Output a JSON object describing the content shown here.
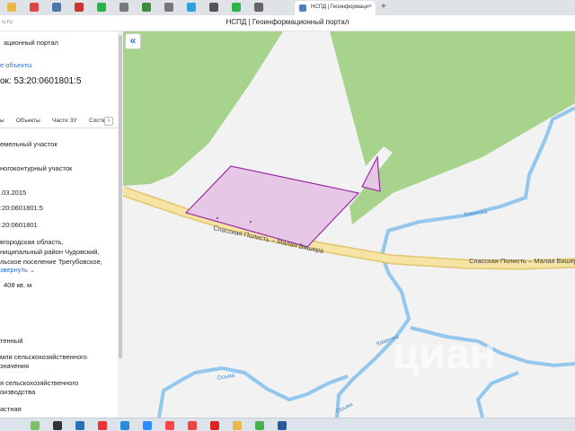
{
  "browser": {
    "url_fragment": "u.ru",
    "active_tab_title": "НСПД | Геоинформаци",
    "page_title": "НСПД | Геоинформационный портал",
    "new_tab_label": "+",
    "close_tab_label": "×"
  },
  "panel": {
    "portal_name": "ационный портал",
    "nearby_link": "е объекты",
    "cadastral_heading": "ок: 53:20:0601801:5",
    "tabs": [
      "ы",
      "Объекты",
      "Части ЗУ",
      "Соств"
    ],
    "tabs_next": "›",
    "fields": {
      "type": "емельный участок",
      "subtype": "ногоконтурный участок",
      "date": ".03.2015",
      "number": ":20:0601801:5",
      "quarter": ":20:0601801",
      "address_line1": "вгородская область,",
      "address_line2": "ниципальный район Чудовский,",
      "address_line3": "льское поселение Трегубовское,",
      "expand_link": "звернуть",
      "area": "408 кв. м",
      "status": "тенный",
      "category_line1": "мли сельскохозяйственного",
      "category_line2": "значения",
      "use_line1": "я сельскохозяйственного",
      "use_line2": "оизводства",
      "ownership": "астная"
    }
  },
  "map": {
    "collapse_label": "«",
    "road_label_1": "Спасская Полисть – Малая Вишера",
    "road_label_2": "Спасская Полисть – Малая Вишера",
    "river_label_1": "Каменка",
    "river_label_2": "Каменка",
    "river_label_3": "Осьма",
    "river_label_4": "Осьма",
    "watermark": "циан",
    "colors": {
      "forest": "#a8d38c",
      "background": "#f2f2f2",
      "parcel_fill": "#e6c8e6",
      "parcel_stroke": "#9b2aa6",
      "road": "#f3dc8e",
      "river": "#93c7ee"
    }
  },
  "browser_tab_icons": [
    {
      "name": "folder-icon",
      "color": "#e8b84a"
    },
    {
      "name": "mail-icon",
      "color": "#d44"
    },
    {
      "name": "vk-icon",
      "color": "#4a76a8"
    },
    {
      "name": "gmail-icon",
      "color": "#c33"
    },
    {
      "name": "whatsapp-icon",
      "color": "#2bb34a"
    },
    {
      "name": "site-icon",
      "color": "#7a7a7a"
    },
    {
      "name": "site-icon",
      "color": "#3c8d3c"
    },
    {
      "name": "site-icon",
      "color": "#777"
    },
    {
      "name": "telegram-icon",
      "color": "#2aa3de"
    },
    {
      "name": "site-icon",
      "color": "#555"
    },
    {
      "name": "whatsapp-icon",
      "color": "#2bb34a"
    },
    {
      "name": "site-icon",
      "color": "#666"
    }
  ],
  "taskbar_icons": [
    {
      "name": "photos-icon",
      "color": "#7fbf6a"
    },
    {
      "name": "video-icon",
      "color": "#333"
    },
    {
      "name": "media-icon",
      "color": "#2b6fb5"
    },
    {
      "name": "yandex-icon",
      "color": "#e33"
    },
    {
      "name": "skype-icon",
      "color": "#2b8dd8"
    },
    {
      "name": "zoom-icon",
      "color": "#2d8cff"
    },
    {
      "name": "yandex-browser-icon",
      "color": "#f44"
    },
    {
      "name": "chrome-icon",
      "color": "#e44"
    },
    {
      "name": "opera-icon",
      "color": "#d22"
    },
    {
      "name": "explorer-icon",
      "color": "#e8b84a"
    },
    {
      "name": "chrome-icon",
      "color": "#4caf50"
    },
    {
      "name": "word-icon",
      "color": "#2b579a"
    }
  ]
}
